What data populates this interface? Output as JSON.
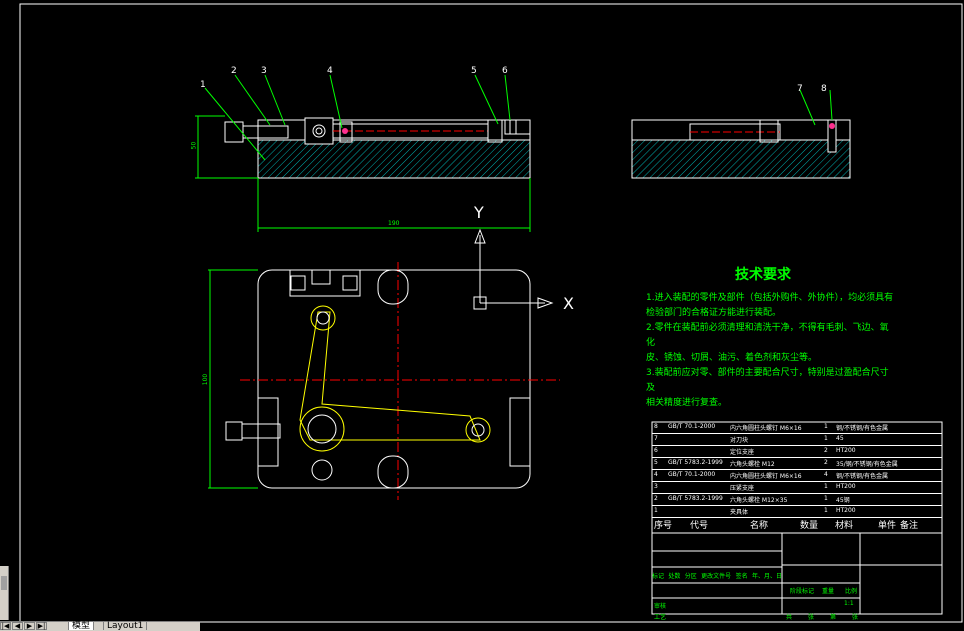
{
  "tech_title": "技术要求",
  "tech_lines": [
    "1.进入装配的零件及部件（包括外购件、外协件），均必须具有",
    "检验部门的合格证方能进行装配。",
    "2.零件在装配前必须清理和清洗干净，不得有毛刺、飞边、氧化",
    "皮、锈蚀、切屑、油污、着色剂和灰尘等。",
    "3.装配前应对零、部件的主要配合尺寸，特别是过盈配合尺寸及",
    "相关精度进行复查。"
  ],
  "balloons": [
    "1",
    "2",
    "3",
    "4",
    "5",
    "6",
    "7",
    "8"
  ],
  "dims": {
    "height": "50",
    "width": "190",
    "length": "100"
  },
  "axis": {
    "y": "Y",
    "x": "X"
  },
  "bom_rows": [
    {
      "no": "8",
      "code": "GB/T 70.1-2000",
      "name": "内六角圆柱头螺钉 M6×16",
      "qty": "1",
      "mat": "钢/不锈钢/有色金属"
    },
    {
      "no": "7",
      "code": "",
      "name": "对刀块",
      "qty": "1",
      "mat": "45"
    },
    {
      "no": "6",
      "code": "",
      "name": "定位支座",
      "qty": "2",
      "mat": "HT200"
    },
    {
      "no": "5",
      "code": "GB/T 5783.2-1999",
      "name": "六角头螺栓 M12",
      "qty": "2",
      "mat": "35/钢/不锈钢/有色金属"
    },
    {
      "no": "4",
      "code": "GB/T 70.1-2000",
      "name": "内六角圆柱头螺钉 M6×16",
      "qty": "4",
      "mat": "钢/不锈钢/有色金属"
    },
    {
      "no": "3",
      "code": "",
      "name": "压紧支座",
      "qty": "1",
      "mat": "HT200"
    },
    {
      "no": "2",
      "code": "GB/T 5783.2-1999",
      "name": "六角头螺栓 M12×35",
      "qty": "1",
      "mat": "45钢"
    },
    {
      "no": "1",
      "code": "",
      "name": "夹具体",
      "qty": "1",
      "mat": "HT200"
    }
  ],
  "bom_headers": {
    "no": "序号",
    "code": "代号",
    "name": "名称",
    "qty": "数量",
    "mat": "材料",
    "single": "单件",
    "total": "总计",
    "weight": "重量",
    "note": "备注"
  },
  "title_block": {
    "left_labels": [
      "标记",
      "处数",
      "分区",
      "更改文件号",
      "签名",
      "年、月、日"
    ],
    "design": "设计",
    "approve": "审核",
    "process": "工艺",
    "stage_mark": "阶段标记",
    "weight": "重量",
    "scale": "比例",
    "scale_value": "1:1",
    "sheet_a": "共",
    "sheet_b": "张",
    "sheet_c": "第",
    "sheet_d": "张"
  },
  "tabs": [
    "模型",
    "Layout1"
  ],
  "colors": {
    "background": "#000000",
    "white": "#ffffff",
    "green": "#00ff00",
    "yellow": "#ffff00",
    "red": "#ff0000",
    "hatch": "#00d0d0"
  }
}
